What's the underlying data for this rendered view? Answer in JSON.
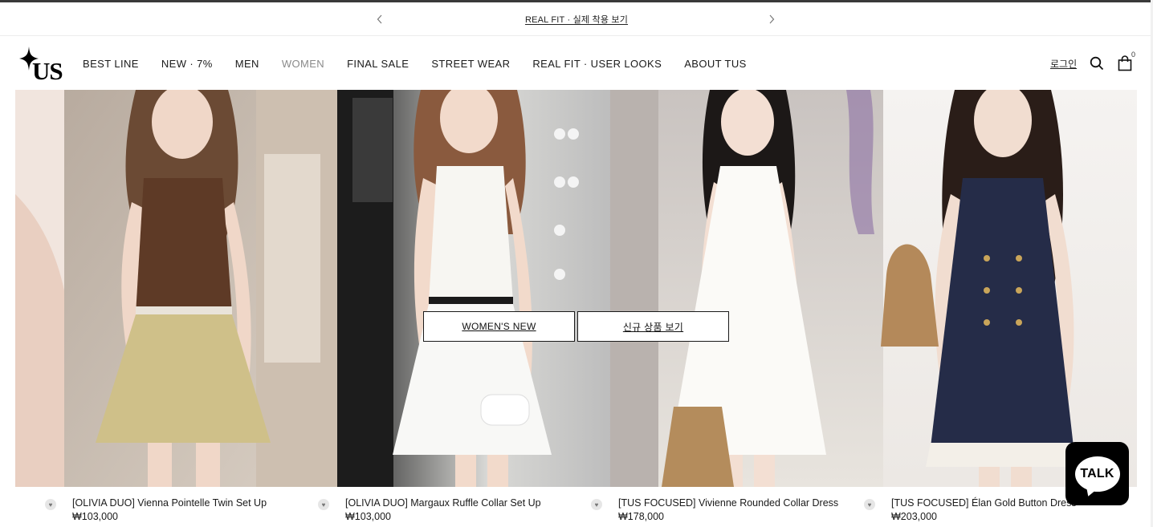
{
  "announcement": {
    "text": "REAL FIT · 실제 착용 보기",
    "prev_icon": "chevron-left-icon",
    "next_icon": "chevron-right-icon"
  },
  "brand": {
    "logo_text": "TUS"
  },
  "nav": {
    "items": [
      {
        "label": "BEST LINE"
      },
      {
        "label": "NEW · 7%"
      },
      {
        "label": "MEN"
      },
      {
        "label": "WOMEN",
        "state": "dimmed"
      },
      {
        "label": "FINAL SALE"
      },
      {
        "label": "STREET WEAR"
      },
      {
        "label": "REAL FIT · USER LOOKS"
      },
      {
        "label": "ABOUT TUS"
      }
    ]
  },
  "utility": {
    "login": "로그인",
    "search_icon": "search-icon",
    "cart_icon": "shopping-bag-icon",
    "cart_count": "0"
  },
  "hero": {
    "cta_primary": "WOMEN'S NEW",
    "cta_secondary": "신규 상품 보기"
  },
  "products": [
    {
      "name": "[OLIVIA DUO] Vienna Pointelle Twin Set Up",
      "price": "₩103,000"
    },
    {
      "name": "[OLIVIA DUO] Margaux Ruffle Collar Set Up",
      "price": "₩103,000"
    },
    {
      "name": "[TUS FOCUSED] Vivienne Rounded Collar Dress",
      "price": "₩178,000"
    },
    {
      "name": "[TUS FOCUSED] Élan Gold Button Dress",
      "price": "₩203,000"
    }
  ],
  "chat": {
    "label": "TALK"
  },
  "colors": {
    "text": "#1a1a1a",
    "nav_dimmed": "#8a8a8a",
    "chat_bg": "#000000"
  }
}
